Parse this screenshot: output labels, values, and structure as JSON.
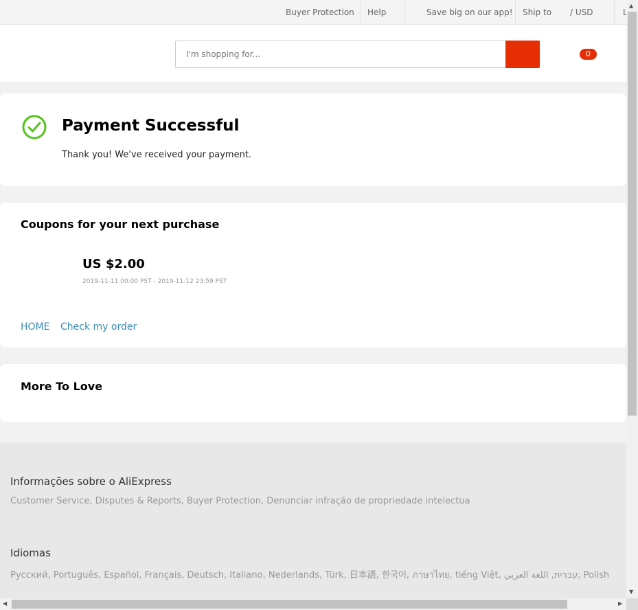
{
  "topbar": {
    "buyer_protection": "Buyer Protection",
    "help": "Help",
    "app": "Save big on our app!",
    "ship_to": "Ship to",
    "currency": "/  USD",
    "language_stub": "L"
  },
  "header": {
    "search_placeholder": "I'm shopping for...",
    "cart_count": "0"
  },
  "payment": {
    "title": "Payment Successful",
    "message": "Thank you! We've received your payment."
  },
  "coupons": {
    "title": "Coupons for your next purchase",
    "amount": "US $2.00",
    "dates": "2019-11-11 00:00 PST - 2019-11-12 23:59 PST"
  },
  "links": {
    "home": "HOME",
    "check_order": "Check my order"
  },
  "more": {
    "title": "More To Love"
  },
  "footer": {
    "info_title": "Informações sobre o AliExpress",
    "info_links": "Customer Service, Disputes & Reports, Buyer Protection, Denunciar infração de propriedade intelectua",
    "lang_title": "Idiomas",
    "lang_links": "Русский, Português, Español, Français, Deutsch, Italiano, Nederlands, Türk, 日本語, 한국어, ภาษาไทย, tiếng Việt, עברית, اللغة العربي, Polish"
  },
  "colors": {
    "accent": "#e62e04",
    "link": "#3a8bb4",
    "success": "#52c41a"
  }
}
